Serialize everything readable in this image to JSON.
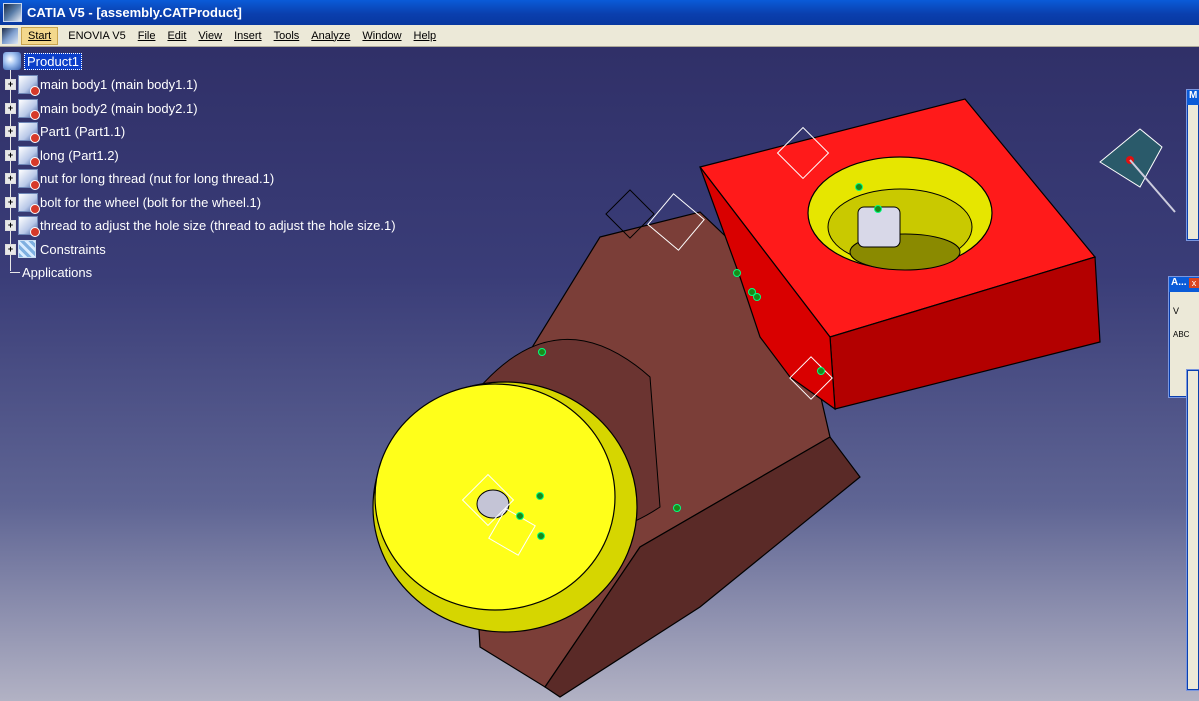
{
  "window": {
    "title": "CATIA V5 - [assembly.CATProduct]"
  },
  "menubar": {
    "start": "Start",
    "enovia": "ENOVIA V5",
    "items": [
      "File",
      "Edit",
      "View",
      "Insert",
      "Tools",
      "Analyze",
      "Window",
      "Help"
    ]
  },
  "tree": {
    "root": "Product1",
    "children": [
      "main body1 (main body1.1)",
      "main body2 (main body2.1)",
      "Part1 (Part1.1)",
      "long (Part1.2)",
      "nut for long thread (nut for long thread.1)",
      "bolt for the wheel (bolt for the wheel.1)",
      "thread to adjust the hole size (thread to adjust the hole size.1)"
    ],
    "constraints": "Constraints",
    "applications": "Applications"
  },
  "panels": {
    "top_right_caption": "M",
    "analysis_caption": "A...",
    "analysis_label_1": "V",
    "analysis_label_2": "ABC"
  },
  "colors": {
    "red_block": "#ff0000",
    "yellow_wheel": "#ffff00",
    "brown_body": "#7a3f3a",
    "viewport_top": "#303068"
  }
}
